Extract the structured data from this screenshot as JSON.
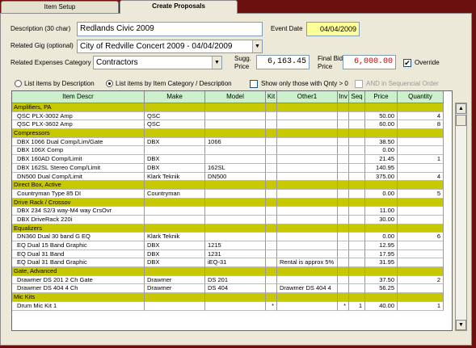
{
  "tabs": [
    {
      "label": "Item Setup"
    },
    {
      "label": "Create Proposals"
    }
  ],
  "form": {
    "description_label": "Description (30 char)",
    "description_value": "Redlands Civic 2009",
    "event_date_label": "Event Date",
    "event_date_value": "04/04/2009",
    "related_gig_label": "Related Gig (optional)",
    "related_gig_value": "City of Redville Concert 2009 - 04/04/2009",
    "related_expenses_label": "Related Expenses Category",
    "related_expenses_value": "Contractors",
    "sugg_price_label_1": "Sugg.",
    "sugg_price_label_2": "Price",
    "sugg_price_value": "6,163.45",
    "final_bid_label_1": "Final Bid",
    "final_bid_label_2": "Price",
    "final_bid_value": "6,000.00",
    "override_label": "Override",
    "override_checked": "✔"
  },
  "options": {
    "list_by_description": "List items by Description",
    "list_by_category": "List items by Item Category / Description",
    "show_only_qnty": "Show only those with Qnty > 0",
    "and_in_sequential": "AND in Sequencial Order"
  },
  "grid": {
    "headers": [
      "Item Descr",
      "Make",
      "Model",
      "Kit",
      "Other1",
      "Inv",
      "Seq",
      "Price",
      "Quantity"
    ],
    "rows": [
      {
        "type": "cat",
        "cells": [
          "Amplifiers, PA",
          "",
          "",
          "",
          "",
          "",
          "",
          "",
          ""
        ]
      },
      {
        "type": "item",
        "cells": [
          "QSC PLX-3002 Amp",
          "QSC",
          "",
          "",
          "",
          "",
          "",
          "50.00",
          "4"
        ]
      },
      {
        "type": "item",
        "cells": [
          "QSC PLX-3602 Amp",
          "QSC",
          "",
          "",
          "",
          "",
          "",
          "60.00",
          "8"
        ]
      },
      {
        "type": "cat",
        "cells": [
          "Compressors",
          "",
          "",
          "",
          "",
          "",
          "",
          "",
          ""
        ]
      },
      {
        "type": "item",
        "cells": [
          "DBX 1066 Dual Comp/Lim/Gate",
          "DBX",
          "1066",
          "",
          "",
          "",
          "",
          "38.50",
          ""
        ]
      },
      {
        "type": "item",
        "cells": [
          "DBX 106X Comp",
          "",
          "",
          "",
          "",
          "",
          "",
          "0.00",
          ""
        ]
      },
      {
        "type": "item",
        "cells": [
          "DBX 160AD Comp/Limit",
          "DBX",
          "",
          "",
          "",
          "",
          "",
          "21.45",
          "1"
        ]
      },
      {
        "type": "item",
        "cells": [
          "DBX 162SL Stereo Comp/Limit",
          "DBX",
          "162SL",
          "",
          "",
          "",
          "",
          "140.95",
          ""
        ]
      },
      {
        "type": "item",
        "cells": [
          "DN500 Dual Comp/Limit",
          "Klark Teknik",
          "DN500",
          "",
          "",
          "",
          "",
          "375.00",
          "4"
        ]
      },
      {
        "type": "cat",
        "cells": [
          "Direct Box, Active",
          "",
          "",
          "",
          "",
          "",
          "",
          "",
          ""
        ]
      },
      {
        "type": "item",
        "cells": [
          "Countryman Type 85 DI",
          "Countryman",
          "",
          "",
          "",
          "",
          "",
          "0.00",
          "5"
        ]
      },
      {
        "type": "cat",
        "cells": [
          "Drive Rack / Crossov",
          "",
          "",
          "",
          "",
          "",
          "",
          "",
          ""
        ]
      },
      {
        "type": "item",
        "cells": [
          "DBX 234 S2/3 way-M4 way CrsOvr",
          "",
          "",
          "",
          "",
          "",
          "",
          "11.00",
          ""
        ]
      },
      {
        "type": "item",
        "cells": [
          "DBX DriveRack 220i",
          "",
          "",
          "",
          "",
          "",
          "",
          "30.00",
          ""
        ]
      },
      {
        "type": "cat",
        "cells": [
          "Equalizers",
          "",
          "",
          "",
          "",
          "",
          "",
          "",
          ""
        ]
      },
      {
        "type": "item",
        "cells": [
          "DN360 Dual 30 band G EQ",
          "Klark Teknik",
          "",
          "",
          "",
          "",
          "",
          "0.00",
          "6"
        ]
      },
      {
        "type": "item",
        "cells": [
          "EQ Dual 15 Band Graphic",
          "DBX",
          "1215",
          "",
          "",
          "",
          "",
          "12.95",
          ""
        ]
      },
      {
        "type": "item",
        "cells": [
          "EQ Dual 31 Band",
          "DBX",
          "1231",
          "",
          "",
          "",
          "",
          "17.95",
          ""
        ]
      },
      {
        "type": "item",
        "cells": [
          "EQ Dual 31 Band Graphic",
          "DBX",
          "iEQ-31",
          "",
          "Rental is approx 5%",
          "",
          "",
          "31.95",
          ""
        ]
      },
      {
        "type": "cat",
        "cells": [
          "Gate, Advanced",
          "",
          "",
          "",
          "",
          "",
          "",
          "",
          ""
        ]
      },
      {
        "type": "item",
        "cells": [
          "Drawmer DS 201 2 Ch Gate",
          "Drawmer",
          "DS 201",
          "",
          "",
          "",
          "",
          "37.50",
          "2"
        ]
      },
      {
        "type": "item",
        "cells": [
          "Drawmer DS 404 4 Ch",
          "Drawmer",
          "DS 404",
          "",
          "Drawmer DS 404 4",
          "",
          "",
          "56.25",
          ""
        ]
      },
      {
        "type": "cat",
        "cells": [
          "Mic Kits",
          "",
          "",
          "",
          "",
          "",
          "",
          "",
          ""
        ]
      },
      {
        "type": "item",
        "cells": [
          "Drum Mic Kit 1",
          "",
          "",
          "*",
          "",
          "*",
          "1",
          "40.00",
          "1"
        ]
      }
    ]
  }
}
